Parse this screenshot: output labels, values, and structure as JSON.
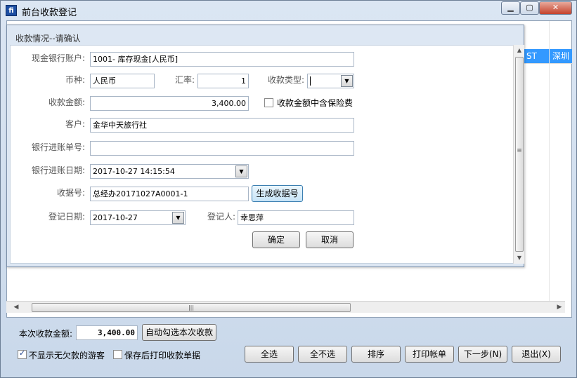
{
  "window": {
    "title": "前台收款登记",
    "min_glyph": "▁",
    "max_glyph": "▢",
    "close_glyph": "✕"
  },
  "grid": {
    "cells": [
      "ST",
      "深圳"
    ]
  },
  "dialog": {
    "title": "收款情况--请确认",
    "bank_account_label": "现金银行账户:",
    "bank_account_value": "1001- 库存现金[人民币]",
    "currency_label": "币种:",
    "currency_value": "人民币",
    "rate_label": "汇率:",
    "rate_value": "1",
    "pay_type_label": "收款类型:",
    "pay_type_value": "",
    "amount_label": "收款金额:",
    "amount_value": "3,400.00",
    "insurance_label": "收款金额中含保险费",
    "insurance_checked": false,
    "customer_label": "客户:",
    "customer_value": "金华中天旅行社",
    "bank_slip_label": "银行进账单号:",
    "bank_slip_value": "",
    "bank_date_label": "银行进账日期:",
    "bank_date_value": "2017-10-27 14:15:54",
    "receipt_no_label": "收据号:",
    "receipt_no_value": "总经办20171027A0001-1",
    "gen_receipt_button": "生成收据号",
    "reg_date_label": "登记日期:",
    "reg_date_value": "2017-10-27",
    "registrar_label": "登记人:",
    "registrar_value": "幸思萍",
    "ok_button": "确定",
    "cancel_button": "取消"
  },
  "footer": {
    "amount_label": "本次收款金额:",
    "amount_value": "3,400.00",
    "auto_select_button": "自动勾选本次收款",
    "hide_no_debt_label": "不显示无欠款的游客",
    "hide_no_debt_checked": true,
    "print_after_save_label": "保存后打印收款单据",
    "print_after_save_checked": false,
    "buttons": {
      "select_all": "全选",
      "select_none": "全不选",
      "sort": "排序",
      "print_bill": "打印帐单",
      "next": "下一步(N)",
      "exit": "退出(X)"
    }
  }
}
